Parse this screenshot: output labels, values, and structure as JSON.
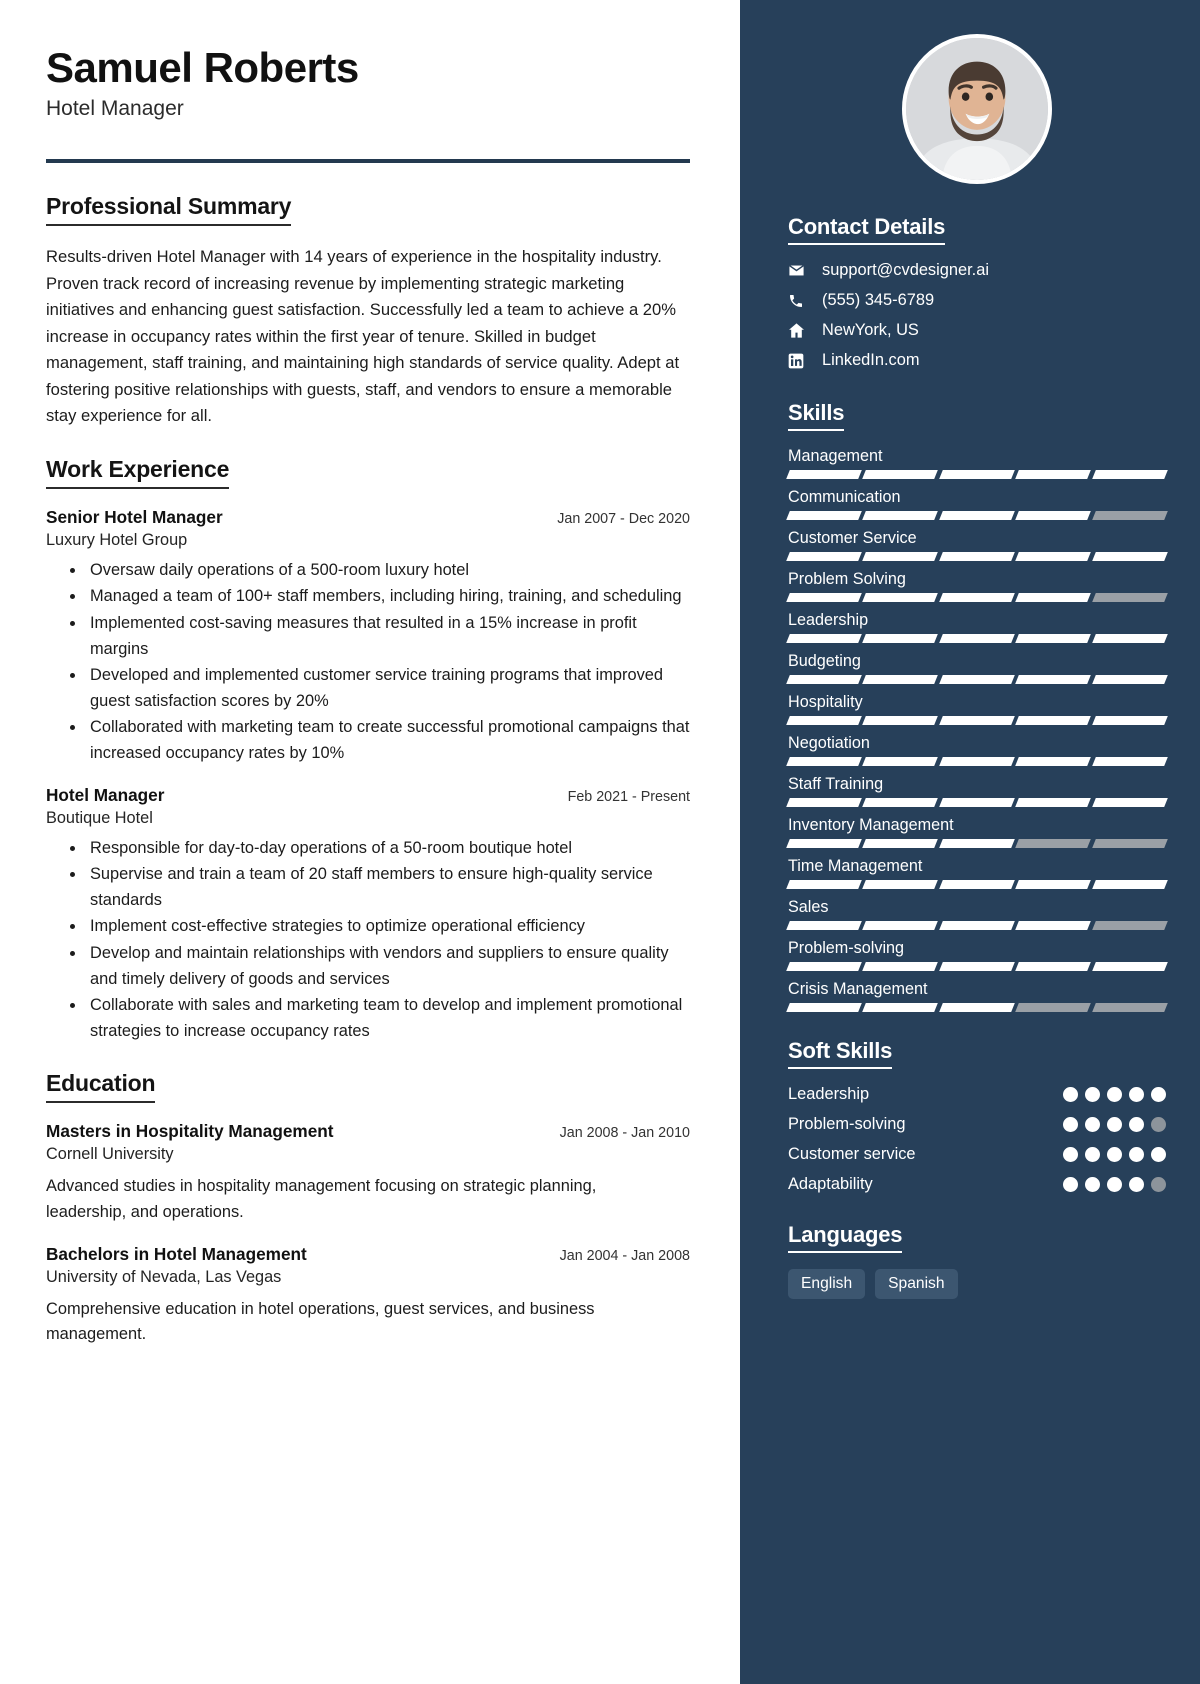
{
  "header": {
    "name": "Samuel Roberts",
    "role": "Hotel Manager"
  },
  "theme": {
    "sidebar_bg": "#27405a",
    "accent_rule": "#23394f",
    "skill_on": "#ffffff",
    "skill_off": "#9aa0a6",
    "pill_bg": "#3c5670"
  },
  "summary": {
    "title": "Professional Summary",
    "text": "Results-driven Hotel Manager with 14 years of experience in the hospitality industry. Proven track record of increasing revenue by implementing strategic marketing initiatives and enhancing guest satisfaction. Successfully led a team to achieve a 20% increase in occupancy rates within the first year of tenure. Skilled in budget management, staff training, and maintaining high standards of service quality. Adept at fostering positive relationships with guests, staff, and vendors to ensure a memorable stay experience for all."
  },
  "work": {
    "title": "Work Experience",
    "jobs": [
      {
        "position": "Senior Hotel Manager",
        "date": "Jan 2007 - Dec 2020",
        "company": "Luxury Hotel Group",
        "bullets": [
          "Oversaw daily operations of a 500-room luxury hotel",
          "Managed a team of 100+ staff members, including hiring, training, and scheduling",
          "Implemented cost-saving measures that resulted in a 15% increase in profit margins",
          "Developed and implemented customer service training programs that improved guest satisfaction scores by 20%",
          "Collaborated with marketing team to create successful promotional campaigns that increased occupancy rates by 10%"
        ]
      },
      {
        "position": "Hotel Manager",
        "date": "Feb 2021 - Present",
        "company": "Boutique Hotel",
        "bullets": [
          "Responsible for day-to-day operations of a 50-room boutique hotel",
          "Supervise and train a team of 20 staff members to ensure high-quality service standards",
          "Implement cost-effective strategies to optimize operational efficiency",
          "Develop and maintain relationships with vendors and suppliers to ensure quality and timely delivery of goods and services",
          "Collaborate with sales and marketing team to develop and implement promotional strategies to increase occupancy rates"
        ]
      }
    ]
  },
  "education": {
    "title": "Education",
    "items": [
      {
        "degree": "Masters in Hospitality Management",
        "date": "Jan 2008 - Jan 2010",
        "school": "Cornell University",
        "description": "Advanced studies in hospitality management focusing on strategic planning, leadership, and operations."
      },
      {
        "degree": "Bachelors in Hotel Management",
        "date": "Jan 2004 - Jan 2008",
        "school": "University of Nevada, Las Vegas",
        "description": "Comprehensive education in hotel operations, guest services, and business management."
      }
    ]
  },
  "contact": {
    "title": "Contact Details",
    "items": [
      {
        "icon": "envelope-icon",
        "value": "support@cvdesigner.ai"
      },
      {
        "icon": "phone-icon",
        "value": "(555) 345-6789"
      },
      {
        "icon": "home-icon",
        "value": "NewYork, US"
      },
      {
        "icon": "linkedin-icon",
        "value": "LinkedIn.com"
      }
    ]
  },
  "skills": {
    "title": "Skills",
    "max": 5,
    "items": [
      {
        "label": "Management",
        "level": 5
      },
      {
        "label": "Communication",
        "level": 4
      },
      {
        "label": "Customer Service",
        "level": 5
      },
      {
        "label": "Problem Solving",
        "level": 4
      },
      {
        "label": "Leadership",
        "level": 5
      },
      {
        "label": "Budgeting",
        "level": 5
      },
      {
        "label": "Hospitality",
        "level": 5
      },
      {
        "label": "Negotiation",
        "level": 5
      },
      {
        "label": "Staff Training",
        "level": 5
      },
      {
        "label": "Inventory Management",
        "level": 3
      },
      {
        "label": "Time Management",
        "level": 5
      },
      {
        "label": "Sales",
        "level": 4
      },
      {
        "label": "Problem-solving",
        "level": 5
      },
      {
        "label": "Crisis Management",
        "level": 3
      }
    ]
  },
  "soft_skills": {
    "title": "Soft Skills",
    "max": 5,
    "items": [
      {
        "label": "Leadership",
        "level": 5
      },
      {
        "label": "Problem-solving",
        "level": 4
      },
      {
        "label": "Customer service",
        "level": 5
      },
      {
        "label": "Adaptability",
        "level": 4
      }
    ]
  },
  "languages": {
    "title": "Languages",
    "items": [
      "English",
      "Spanish"
    ]
  }
}
